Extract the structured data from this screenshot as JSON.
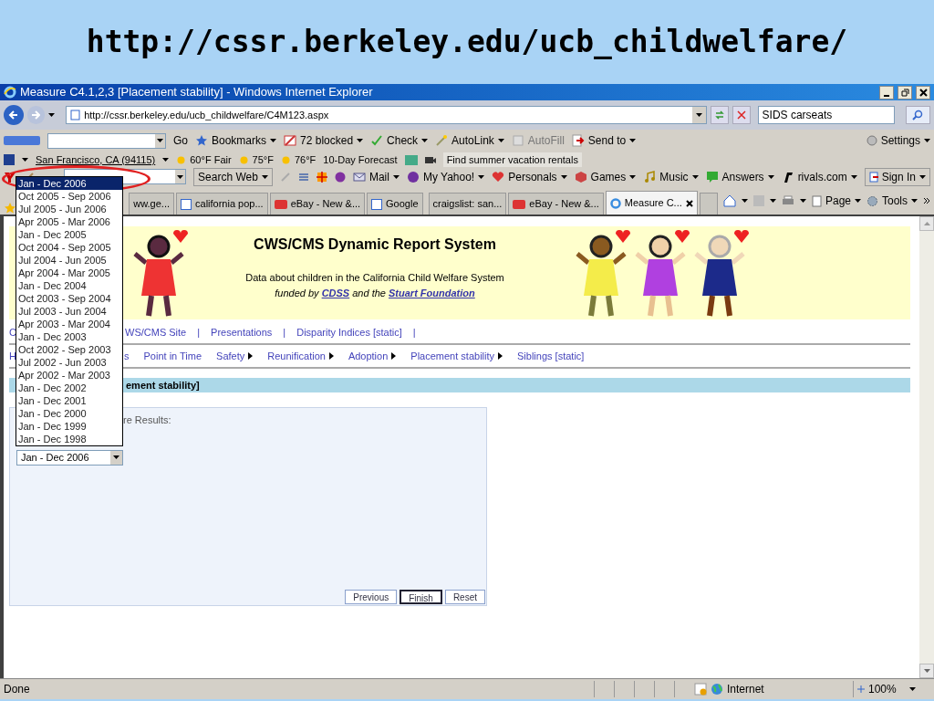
{
  "slide_title": "http://cssr.berkeley.edu/ucb_childwelfare/",
  "window": {
    "title": "Measure C4.1,2,3 [Placement stability] - Windows Internet Explorer"
  },
  "address_bar": {
    "url": "http://cssr.berkeley.edu/ucb_childwelfare/C4M123.aspx",
    "search_value": "SIDS carseats"
  },
  "google_toolbar": {
    "items": [
      {
        "label": "Go",
        "disabled": false
      },
      {
        "label": "Bookmarks",
        "disabled": false
      },
      {
        "label": "72 blocked",
        "disabled": false
      },
      {
        "label": "Check",
        "disabled": false
      },
      {
        "label": "AutoLink",
        "disabled": false
      },
      {
        "label": "AutoFill",
        "disabled": true
      },
      {
        "label": "Send to",
        "disabled": false
      }
    ],
    "settings": "Settings"
  },
  "weather_toolbar": {
    "location": "San Francisco, CA (94115)",
    "items": [
      "60°F Fair",
      "75°F",
      "76°F",
      "10-Day Forecast"
    ],
    "promo": "Find summer vacation rentals"
  },
  "yahoo_toolbar": {
    "search_button": "Search Web",
    "items": [
      "Mail",
      "My Yahoo!",
      "Personals",
      "Games",
      "Music",
      "Answers",
      "rivals.com"
    ],
    "sign_in": "Sign In"
  },
  "tabs": [
    {
      "label": "ww.ge...",
      "selected": false
    },
    {
      "label": "california pop...",
      "selected": false
    },
    {
      "label": "eBay - New &...",
      "selected": false
    },
    {
      "label": "Google",
      "selected": false
    },
    {
      "label": "craigslist: san...",
      "selected": false
    },
    {
      "label": "eBay - New &...",
      "selected": false
    },
    {
      "label": "Measure C...",
      "selected": true
    }
  ],
  "command_bar": [
    "Page",
    "Tools"
  ],
  "page": {
    "header": {
      "title": "CWS/CMS Dynamic Report System",
      "subtitle": "Data about children in the California Child Welfare System",
      "funding": [
        {
          "text": "funded by ",
          "link": false
        },
        {
          "text": "CDSS",
          "link": true
        },
        {
          "text": " and the ",
          "link": false
        },
        {
          "text": "Stuart Foundation",
          "link": true
        }
      ]
    },
    "nav_top": {
      "cut_item": "C",
      "items": [
        {
          "kind": "link",
          "label": "WS/CMS Site"
        },
        {
          "kind": "separator",
          "label": "|"
        },
        {
          "kind": "link",
          "label": "Presentations"
        },
        {
          "kind": "separator",
          "label": "|"
        },
        {
          "kind": "link",
          "label": "Disparity Indices [static]"
        },
        {
          "kind": "separator",
          "label": "|"
        }
      ]
    },
    "nav_bottom": {
      "cut_item": "H",
      "items": [
        {
          "label": "s",
          "submenu": false
        },
        {
          "label": "Point in Time",
          "submenu": false
        },
        {
          "label": "Safety",
          "submenu": true
        },
        {
          "label": "Reunification",
          "submenu": true
        },
        {
          "label": "Adoption",
          "submenu": true
        },
        {
          "label": "Placement stability",
          "submenu": true
        },
        {
          "label": "Siblings [static]",
          "submenu": false
        }
      ]
    },
    "section_title": "ement stability]",
    "form": {
      "label": "re Results:",
      "select_value": "Jan - Dec 2006",
      "buttons": [
        {
          "label": "Previous",
          "focused": false
        },
        {
          "label": "Finish",
          "focused": true
        },
        {
          "label": "Reset",
          "focused": false
        }
      ]
    }
  },
  "dropdown": {
    "options": [
      {
        "label": "Jan - Dec 2006",
        "selected": true
      },
      {
        "label": "Oct 2005 - Sep 2006",
        "selected": false
      },
      {
        "label": "Jul 2005 - Jun 2006",
        "selected": false
      },
      {
        "label": "Apr 2005 - Mar 2006",
        "selected": false
      },
      {
        "label": "Jan - Dec 2005",
        "selected": false
      },
      {
        "label": "Oct 2004 - Sep 2005",
        "selected": false
      },
      {
        "label": "Jul 2004 - Jun 2005",
        "selected": false
      },
      {
        "label": "Apr 2004 - Mar 2005",
        "selected": false
      },
      {
        "label": "Jan - Dec 2004",
        "selected": false
      },
      {
        "label": "Oct 2003 - Sep 2004",
        "selected": false
      },
      {
        "label": "Jul 2003 - Jun 2004",
        "selected": false
      },
      {
        "label": "Apr 2003 - Mar 2004",
        "selected": false
      },
      {
        "label": "Jan - Dec 2003",
        "selected": false
      },
      {
        "label": "Oct 2002 - Sep 2003",
        "selected": false
      },
      {
        "label": "Jul 2002 - Jun 2003",
        "selected": false
      },
      {
        "label": "Apr 2002 - Mar 2003",
        "selected": false
      },
      {
        "label": "Jan - Dec 2002",
        "selected": false
      },
      {
        "label": "Jan - Dec 2001",
        "selected": false
      },
      {
        "label": "Jan - Dec 2000",
        "selected": false
      },
      {
        "label": "Jan - Dec 1999",
        "selected": false
      },
      {
        "label": "Jan - Dec 1998",
        "selected": false
      }
    ]
  },
  "status_bar": {
    "text": "Done",
    "zone": "Internet",
    "zoom": "100%"
  }
}
